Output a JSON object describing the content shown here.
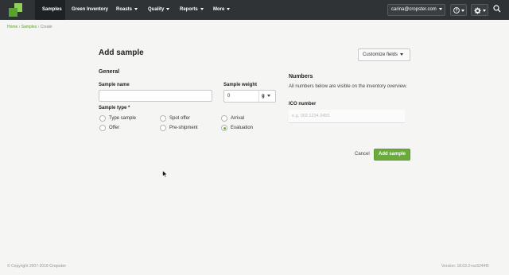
{
  "nav": {
    "items": [
      {
        "label": "Samples",
        "has_caret": false,
        "active": true
      },
      {
        "label": "Green Inventory",
        "has_caret": false,
        "active": false
      },
      {
        "label": "Roasts",
        "has_caret": true,
        "active": false
      },
      {
        "label": "Quality",
        "has_caret": true,
        "active": false
      },
      {
        "label": "Reports",
        "has_caret": true,
        "active": false
      },
      {
        "label": "More",
        "has_caret": true,
        "active": false
      }
    ],
    "user_email": "carina@cropster.com",
    "help_icon": "question-circle-icon",
    "settings_icon": "gear-icon",
    "search_icon": "search-icon",
    "brand_color": "#6aab3b"
  },
  "breadcrumb": {
    "home": "Home",
    "samples": "Samples",
    "current": "Create"
  },
  "page": {
    "title": "Add sample",
    "customize_label": "Customize fields"
  },
  "general": {
    "heading": "General",
    "sample_name_label": "Sample name",
    "sample_name_value": "",
    "sample_weight_label": "Sample weight",
    "sample_weight_value": "0",
    "sample_weight_unit": "g",
    "sample_type_label": "Sample type *",
    "sample_types": [
      {
        "label": "Type sample",
        "selected": false
      },
      {
        "label": "Spot offer",
        "selected": false
      },
      {
        "label": "Arrival",
        "selected": false
      },
      {
        "label": "Offer",
        "selected": false
      },
      {
        "label": "Pre-shipment",
        "selected": false
      },
      {
        "label": "Evaluation",
        "selected": true
      }
    ]
  },
  "numbers": {
    "heading": "Numbers",
    "description": "All numbers below are visible on the inventory overview.",
    "ico_label": "ICO number",
    "ico_placeholder": "e.g. 002.1234.3455"
  },
  "actions": {
    "cancel": "Cancel",
    "submit": "Add sample"
  },
  "footer": {
    "copyright": "© Copyright 2007-2018",
    "brand": "Cropster",
    "version": "Version: 18.03.2+ac5244f5"
  }
}
